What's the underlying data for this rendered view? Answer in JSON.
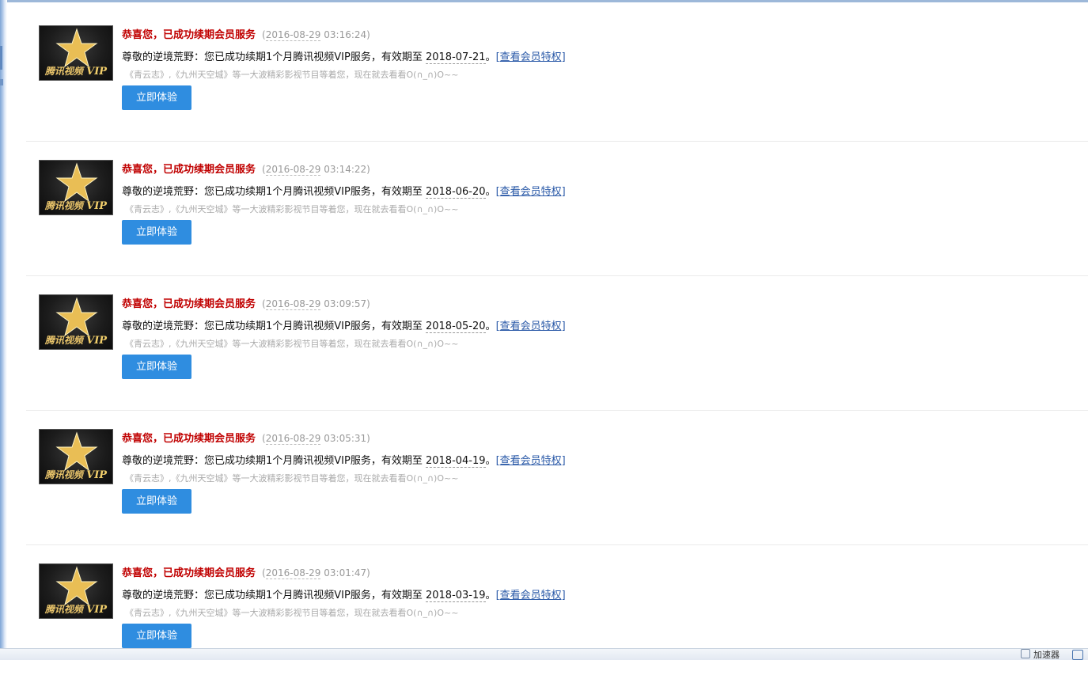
{
  "thumb": {
    "brand_text": "腾讯视频",
    "brand_vip": "VIP"
  },
  "messages": [
    {
      "title": "恭喜您，已成功续期会员服务",
      "date": "2016-08-29",
      "time": " 03:16:24",
      "body_prefix": "尊敬的逆境荒野：您已成功续期1个月腾讯视频VIP服务，有效期至 ",
      "expiry": "2018-07-21",
      "body_suffix": "。",
      "link": "[查看会员特权]",
      "note": "《青云志》,《九州天空城》等一大波精彩影视节目等着您，现在就去看看O(∩_∩)O~~",
      "button": "立即体验"
    },
    {
      "title": "恭喜您，已成功续期会员服务",
      "date": "2016-08-29",
      "time": " 03:14:22",
      "body_prefix": "尊敬的逆境荒野：您已成功续期1个月腾讯视频VIP服务，有效期至 ",
      "expiry": "2018-06-20",
      "body_suffix": "。",
      "link": "[查看会员特权]",
      "note": "《青云志》,《九州天空城》等一大波精彩影视节目等着您，现在就去看看O(∩_∩)O~~",
      "button": "立即体验"
    },
    {
      "title": "恭喜您，已成功续期会员服务",
      "date": "2016-08-29",
      "time": " 03:09:57",
      "body_prefix": "尊敬的逆境荒野：您已成功续期1个月腾讯视频VIP服务，有效期至 ",
      "expiry": "2018-05-20",
      "body_suffix": "。",
      "link": "[查看会员特权]",
      "note": "《青云志》,《九州天空城》等一大波精彩影视节目等着您，现在就去看看O(∩_∩)O~~",
      "button": "立即体验"
    },
    {
      "title": "恭喜您，已成功续期会员服务",
      "date": "2016-08-29",
      "time": " 03:05:31",
      "body_prefix": "尊敬的逆境荒野：您已成功续期1个月腾讯视频VIP服务，有效期至 ",
      "expiry": "2018-04-19",
      "body_suffix": "。",
      "link": "[查看会员特权]",
      "note": "《青云志》,《九州天空城》等一大波精彩影视节目等着您，现在就去看看O(∩_∩)O~~",
      "button": "立即体验"
    },
    {
      "title": "恭喜您，已成功续期会员服务",
      "date": "2016-08-29",
      "time": " 03:01:47",
      "body_prefix": "尊敬的逆境荒野：您已成功续期1个月腾讯视频VIP服务，有效期至 ",
      "expiry": "2018-03-19",
      "body_suffix": "。",
      "link": "[查看会员特权]",
      "note": "《青云志》,《九州天空城》等一大波精彩影视节目等着您，现在就去看看O(∩_∩)O~~",
      "button": "立即体验"
    }
  ],
  "statusbar": {
    "accelerator": "加速器"
  }
}
